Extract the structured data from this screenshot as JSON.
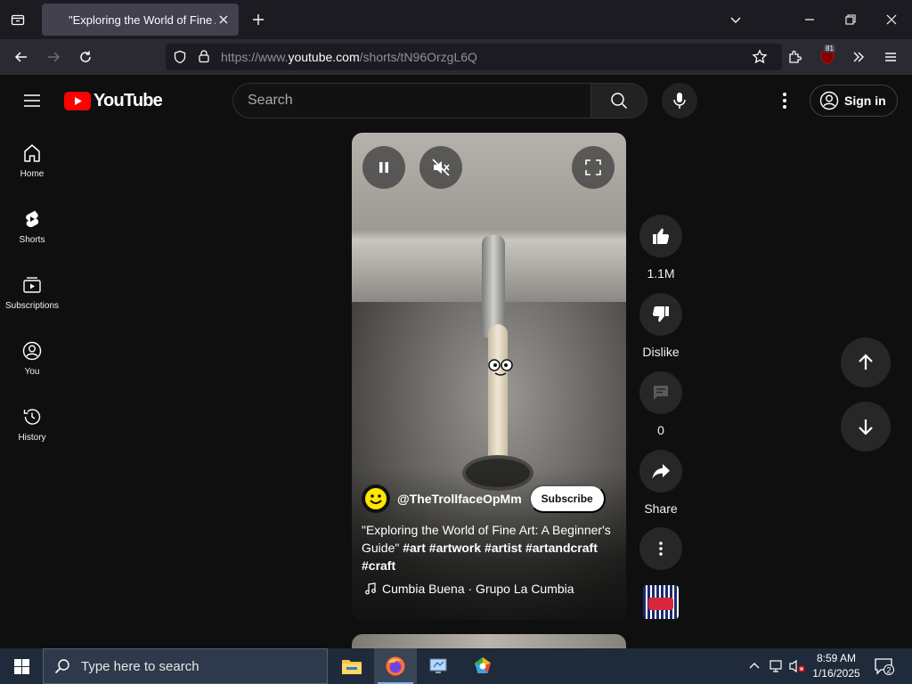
{
  "browser": {
    "tab_title": "\"Exploring the World of Fine Art: A Beginner's Guide\"",
    "url_prefix": "https://www.",
    "url_domain": "youtube.com",
    "url_path": "/shorts/tN96OrzgL6Q",
    "extension_badge": "81"
  },
  "masthead": {
    "logo_text": "YouTube",
    "search_placeholder": "Search",
    "sign_in_label": "Sign in"
  },
  "sidebar": {
    "items": [
      {
        "label": "Home",
        "icon": "home-icon"
      },
      {
        "label": "Shorts",
        "icon": "shorts-icon"
      },
      {
        "label": "Subscriptions",
        "icon": "subscriptions-icon"
      },
      {
        "label": "You",
        "icon": "you-icon"
      },
      {
        "label": "History",
        "icon": "history-icon"
      }
    ]
  },
  "short": {
    "channel_handle": "@TheTrollfaceOpMm",
    "subscribe_label": "Subscribe",
    "title_text": "\"Exploring the World of Fine Art: A Beginner's Guide\"",
    "hashtags": "#art #artwork #artist #artandcraft #craft",
    "music": "Cumbia Buena · Grupo La Cumbia"
  },
  "actions": {
    "like_count": "1.1M",
    "dislike_label": "Dislike",
    "comment_count": "0",
    "share_label": "Share"
  },
  "taskbar": {
    "search_placeholder": "Type here to search",
    "time": "8:59 AM",
    "date": "1/16/2025",
    "notification_count": "2"
  },
  "colors": {
    "yt_red": "#ff0000",
    "background": "#0f0f0f",
    "action_circle": "#272727"
  }
}
